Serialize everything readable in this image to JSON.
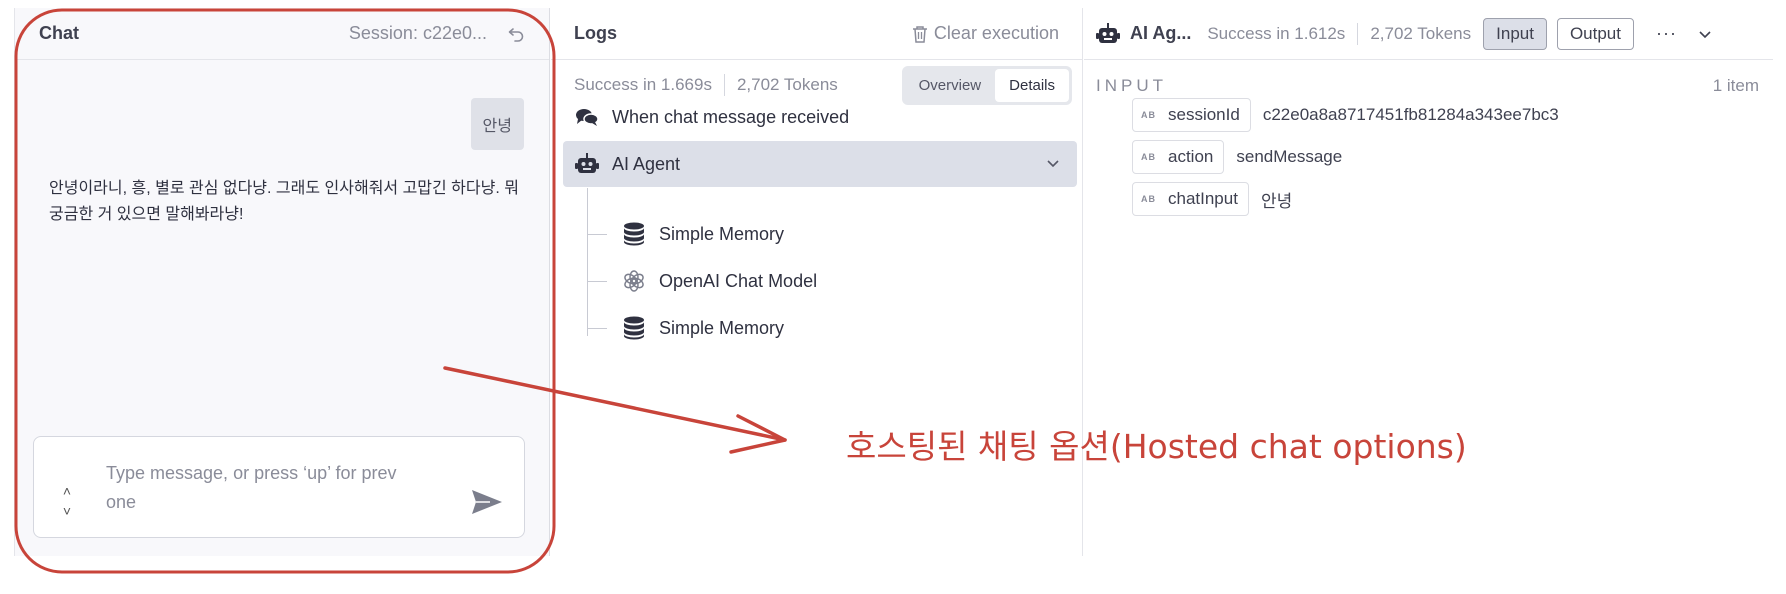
{
  "chat": {
    "title": "Chat",
    "session": "Session: c22e0...",
    "messages": {
      "user": "안녕",
      "bot": "안녕이라니, 흥, 별로 관심 없다냥. 그래도 인사해줘서 고맙긴 하다냥. 뭐 궁금한 거 있으면 말해봐라냥!"
    },
    "input_placeholder": "Type message, or press ‘up’ for prev one"
  },
  "logs": {
    "title": "Logs",
    "clear_label": "Clear execution",
    "status": "Success in 1.669s",
    "tokens": "2,702 Tokens",
    "tabs": [
      "Overview",
      "Details"
    ],
    "active_tab": "Details",
    "tree": [
      {
        "label": "When chat message received",
        "icon": "chat-bubbles-icon"
      },
      {
        "label": "AI Agent",
        "icon": "robot-icon",
        "selected": true
      },
      {
        "label": "Simple Memory",
        "icon": "database-icon"
      },
      {
        "label": "OpenAI Chat Model",
        "icon": "openai-icon"
      },
      {
        "label": "Simple Memory",
        "icon": "database-icon"
      }
    ]
  },
  "detail": {
    "node_name": "AI Ag...",
    "status": "Success in 1.612s",
    "tokens": "2,702 Tokens",
    "input_label": "Input",
    "output_label": "Output",
    "active_view": "Input",
    "section_label": "INPUT",
    "item_count": "1 item",
    "fields": [
      {
        "type": "AB",
        "name": "sessionId",
        "value": "c22e0a8a8717451fb81284a343ee7bc3"
      },
      {
        "type": "AB",
        "name": "action",
        "value": "sendMessage"
      },
      {
        "type": "AB",
        "name": "chatInput",
        "value": "안녕"
      }
    ]
  },
  "annotation": {
    "text": "호스팅된 채팅 옵션(Hosted chat options)",
    "color": "#c8443a"
  },
  "colors": {
    "selected_row": "#dcdfe8",
    "muted_text": "#8a8c99",
    "annotation_red": "#c8443a"
  }
}
